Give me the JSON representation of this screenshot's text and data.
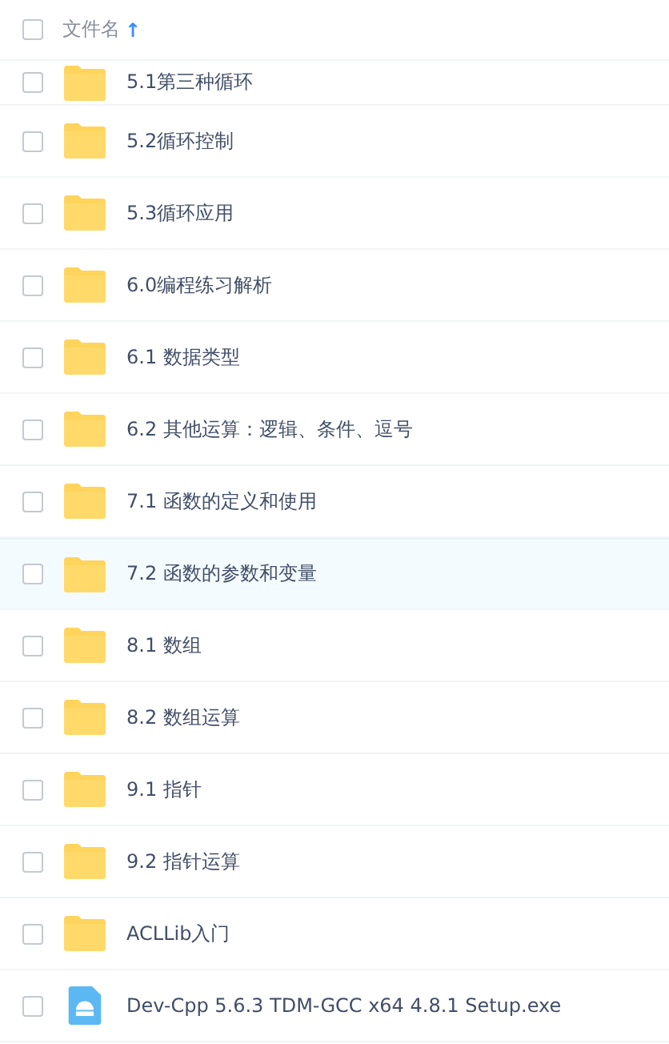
{
  "header": {
    "checked": false,
    "label": "文件名",
    "sort_icon": "↑"
  },
  "files": [
    {
      "name": "5.1第三种循环",
      "kind": "folder",
      "checked": false,
      "highlighted": false
    },
    {
      "name": "5.2循环控制",
      "kind": "folder",
      "checked": false,
      "highlighted": false
    },
    {
      "name": "5.3循环应用",
      "kind": "folder",
      "checked": false,
      "highlighted": false
    },
    {
      "name": "6.0编程练习解析",
      "kind": "folder",
      "checked": false,
      "highlighted": false
    },
    {
      "name": "6.1 数据类型",
      "kind": "folder",
      "checked": false,
      "highlighted": false
    },
    {
      "name": "6.2 其他运算：逻辑、条件、逗号",
      "kind": "folder",
      "checked": false,
      "highlighted": false
    },
    {
      "name": "7.1 函数的定义和使用",
      "kind": "folder",
      "checked": false,
      "highlighted": false
    },
    {
      "name": "7.2 函数的参数和变量",
      "kind": "folder",
      "checked": false,
      "highlighted": true
    },
    {
      "name": "8.1 数组",
      "kind": "folder",
      "checked": false,
      "highlighted": false
    },
    {
      "name": "8.2 数组运算",
      "kind": "folder",
      "checked": false,
      "highlighted": false
    },
    {
      "name": "9.1 指针",
      "kind": "folder",
      "checked": false,
      "highlighted": false
    },
    {
      "name": "9.2 指针运算",
      "kind": "folder",
      "checked": false,
      "highlighted": false
    },
    {
      "name": "ACLLib入门",
      "kind": "folder",
      "checked": false,
      "highlighted": false
    },
    {
      "name": "Dev-Cpp 5.6.3 TDM-GCC x64 4.8.1 Setup.exe",
      "kind": "installer",
      "checked": false,
      "highlighted": false
    }
  ]
}
